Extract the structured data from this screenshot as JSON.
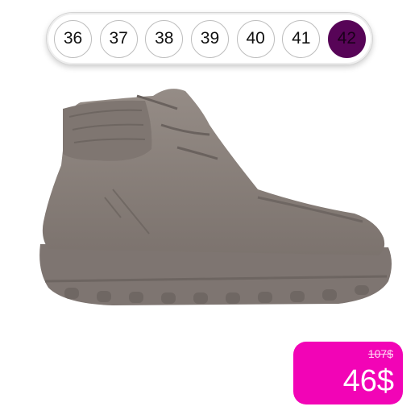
{
  "sizes": {
    "options": [
      "36",
      "37",
      "38",
      "39",
      "40",
      "41",
      "42"
    ],
    "selected": "42"
  },
  "product": {
    "image_icon": "boot-icon"
  },
  "price": {
    "old": "107$",
    "new": "46$"
  },
  "colors": {
    "accent": "#570457",
    "price_tag": "#f204b6",
    "boot": "#867c76"
  }
}
